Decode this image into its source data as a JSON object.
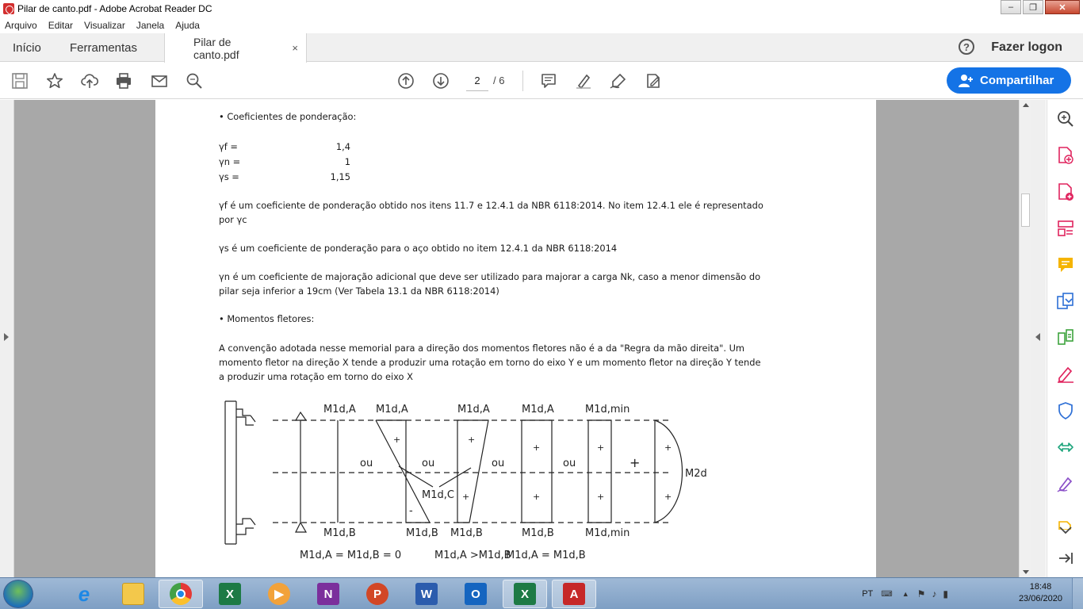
{
  "window": {
    "title": "Pilar de canto.pdf - Adobe Acrobat Reader DC"
  },
  "menu": [
    "Arquivo",
    "Editar",
    "Visualizar",
    "Janela",
    "Ajuda"
  ],
  "tabs": {
    "home": "Início",
    "tools": "Ferramentas",
    "document": "Pilar de canto.pdf",
    "close": "×"
  },
  "header": {
    "help": "?",
    "login": "Fazer logon"
  },
  "toolbar": {
    "page_current": "2",
    "page_total": "/ 6",
    "share_label": "Compartilhar"
  },
  "document": {
    "bullet1": "• Coeficientes de ponderação:",
    "gf_label": "γf =",
    "gf_value": "1,4",
    "gn_label": "γn =",
    "gn_value": "1",
    "gs_label": "γs =",
    "gs_value": "1,15",
    "p1_l1": "γf é um coeficiente de ponderação obtido nos itens 11.7 e 12.4.1 da NBR 6118:2014. No item 12.4.1 ele é representado",
    "p1_l2": "por γc",
    "p2": "γs é um coeficiente de ponderação para o aço obtido no item 12.4.1 da NBR 6118:2014",
    "p3_l1": "γn é um coeficiente de majoração adicional que deve ser utilizado para majorar a carga Nk, caso a menor dimensão do",
    "p3_l2": "pilar seja inferior a 19cm (Ver Tabela 13.1 da NBR 6118:2014)",
    "bullet2": "• Momentos fletores:",
    "p4_l1": "A convenção adotada nesse memorial para a direção dos momentos fletores não é a da \"Regra da mão direita\". Um",
    "p4_l2": "momento fletor na direção X tende a produzir uma rotação em torno do eixo Y e um momento fletor na direção Y tende",
    "p4_l3": "a produzir uma rotação em torno do eixo X"
  },
  "figure": {
    "top_labels": [
      "M1d,A",
      "M1d,A",
      "M1d,A",
      "M1d,A",
      "M1d,min"
    ],
    "bottom_labels": [
      "M1d,B",
      "M1d,B",
      "M1d,B",
      "M1d,B",
      "M1d,min"
    ],
    "ou": "ou",
    "plus": "+",
    "minus": "-",
    "mid_label": "M1d,C",
    "m2d": "M2d",
    "caption1": "M1d,A = M1d,B = 0",
    "caption2": "M1d,A >M1d,B",
    "caption3": "M1d,A = M1d,B"
  },
  "taskbar": {
    "apps": [
      "internet-explorer",
      "file-explorer",
      "chrome",
      "excel",
      "media-player",
      "onenote",
      "powerpoint",
      "word",
      "outlook",
      "excel",
      "acrobat"
    ],
    "lang": "PT",
    "time": "18:48",
    "date": "23/06/2020"
  },
  "colors": {
    "accent": "#1473e6",
    "acrobat_red": "#d32f2f",
    "tool_pink": "#e0245e"
  }
}
